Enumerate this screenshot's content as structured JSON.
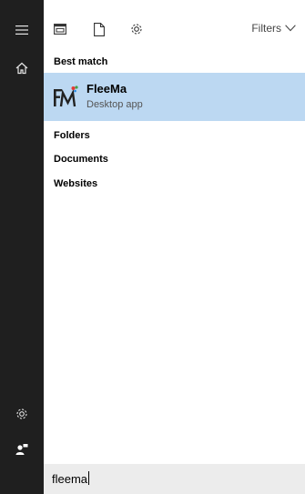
{
  "toolbar": {
    "icons": [
      "documents-icon",
      "file-icon",
      "settings-icon"
    ],
    "filters_label": "Filters"
  },
  "sections": {
    "best_match": "Best match",
    "folders": "Folders",
    "documents": "Documents",
    "websites": "Websites"
  },
  "best_match_result": {
    "title": "FleeMa",
    "subtitle": "Desktop app"
  },
  "search": {
    "value": "fleema"
  },
  "colors": {
    "rail_bg": "#1f1f1f",
    "result_highlight": "#bcd8f2",
    "search_bg": "#ececec"
  }
}
